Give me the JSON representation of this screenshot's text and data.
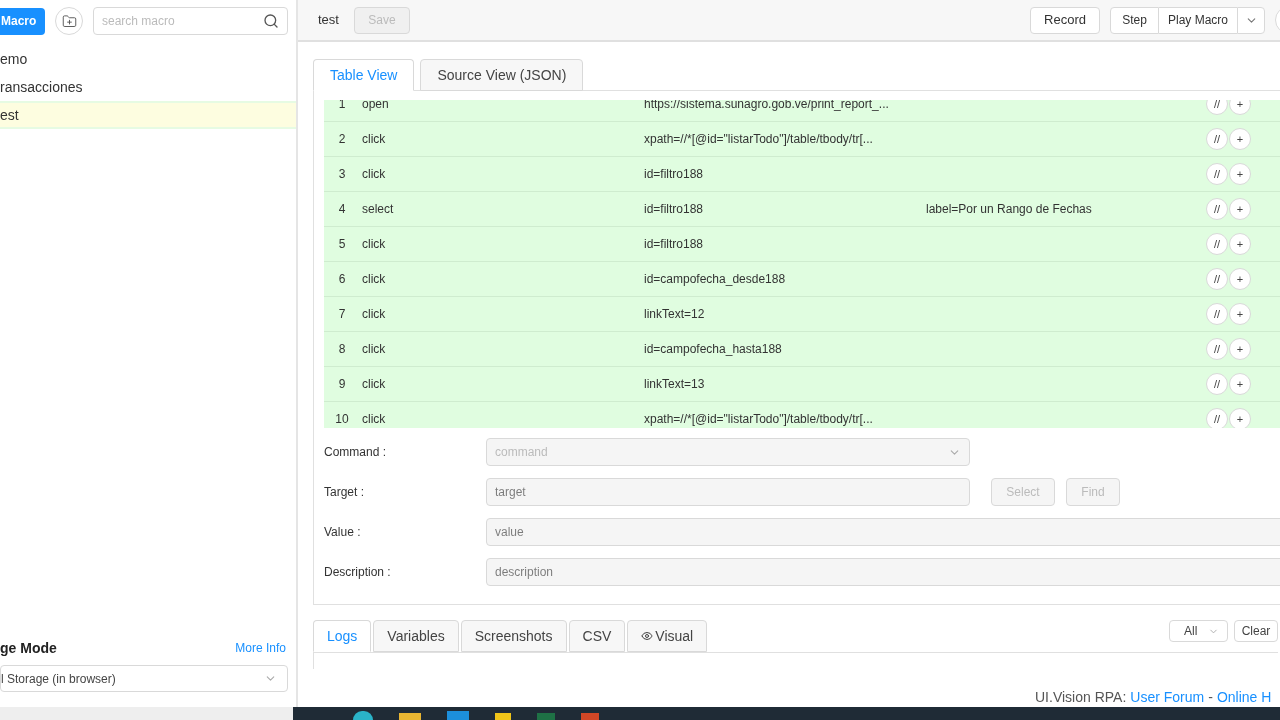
{
  "sidebar": {
    "new_macro_button": "Macro",
    "search": {
      "placeholder": "search macro"
    },
    "items": [
      {
        "label": "emo",
        "selected": false
      },
      {
        "label": "ransacciones",
        "selected": false
      },
      {
        "label": "est",
        "selected": true
      }
    ],
    "storage_mode": {
      "title": "ge Mode",
      "link": "More Info",
      "value": "l Storage (in browser)"
    }
  },
  "toolbar": {
    "macro_name": "test",
    "save": {
      "label": "Save",
      "disabled": true
    },
    "buttons": [
      "Record",
      "Step",
      "Play Macro"
    ]
  },
  "editor_tabs": [
    {
      "label": "Table View",
      "selected": true
    },
    {
      "label": "Source View (JSON)",
      "selected": false
    }
  ],
  "rows": [
    {
      "index": "1",
      "command": "open",
      "target": "https://sistema.sunagro.gob.ve/print_report_...",
      "value": "",
      "actions": [
        "//",
        "+"
      ]
    },
    {
      "index": "2",
      "command": "click",
      "target": "xpath=//*[@id=\"listarTodo\"]/table/tbody/tr[...",
      "value": "",
      "actions": [
        "//",
        "+"
      ]
    },
    {
      "index": "3",
      "command": "click",
      "target": "id=filtro188",
      "value": "",
      "actions": [
        "//",
        "+"
      ]
    },
    {
      "index": "4",
      "command": "select",
      "target": "id=filtro188",
      "value": "label=Por un Rango de Fechas",
      "actions": [
        "//",
        "+"
      ]
    },
    {
      "index": "5",
      "command": "click",
      "target": "id=filtro188",
      "value": "",
      "actions": [
        "//",
        "+"
      ]
    },
    {
      "index": "6",
      "command": "click",
      "target": "id=campofecha_desde188",
      "value": "",
      "actions": [
        "//",
        "+"
      ]
    },
    {
      "index": "7",
      "command": "click",
      "target": "linkText=12",
      "value": "",
      "actions": [
        "//",
        "+"
      ]
    },
    {
      "index": "8",
      "command": "click",
      "target": "id=campofecha_hasta188",
      "value": "",
      "actions": [
        "//",
        "+"
      ]
    },
    {
      "index": "9",
      "command": "click",
      "target": "linkText=13",
      "value": "",
      "actions": [
        "//",
        "+"
      ]
    },
    {
      "index": "10",
      "command": "click",
      "target": "xpath=//*[@id=\"listarTodo\"]/table/tbody/tr[...",
      "value": "",
      "actions": [
        "//",
        "+"
      ]
    }
  ],
  "form": {
    "command": {
      "label": "Command :",
      "placeholder": "command"
    },
    "target": {
      "label": "Target :",
      "placeholder": "target"
    },
    "select_button": "Select",
    "find_button": "Find",
    "value": {
      "label": "Value :",
      "placeholder": "value"
    },
    "description": {
      "label": "Description :",
      "placeholder": "description"
    }
  },
  "bottom_tabs": [
    {
      "label": "Logs",
      "selected": true
    },
    {
      "label": "Variables",
      "selected": false
    },
    {
      "label": "Screenshots",
      "selected": false
    },
    {
      "label": "CSV",
      "selected": false
    },
    {
      "label": "Visual",
      "selected": false
    }
  ],
  "log_filter": "All",
  "clear_button": "Clear",
  "footer": {
    "text": "UI.Vision RPA:",
    "links": [
      "User Forum",
      "Online H"
    ],
    "separator": "-"
  }
}
